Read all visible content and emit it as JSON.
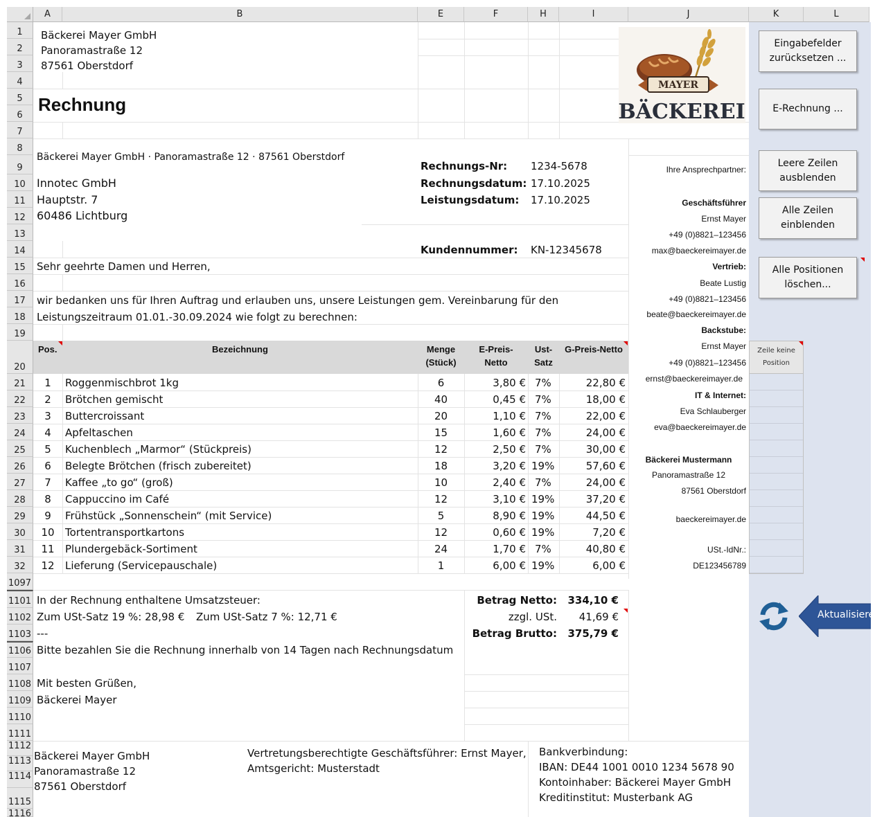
{
  "columns": [
    "A",
    "B",
    "E",
    "F",
    "H",
    "I",
    "J",
    "K",
    "L"
  ],
  "rows": {
    "r1": "1",
    "r2": "2",
    "r3": "3",
    "r4": "4",
    "r5": "5",
    "r6": "6",
    "r7": "7",
    "r8": "8",
    "r9": "9",
    "r10": "10",
    "r11": "11",
    "r12": "12",
    "r13": "13",
    "r14": "14",
    "r15": "15",
    "r16": "16",
    "r17": "17",
    "r18": "18",
    "r19": "19",
    "r20": "20",
    "r21": "21",
    "r22": "22",
    "r23": "23",
    "r24": "24",
    "r25": "25",
    "r26": "26",
    "r27": "27",
    "r28": "28",
    "r29": "29",
    "r30": "30",
    "r31": "31",
    "r32": "32",
    "r1097": "1097",
    "r1101": "1101",
    "r1102": "1102",
    "r1103": "1103",
    "r1106": "1106",
    "r1107": "1107",
    "r1108": "1108",
    "r1109": "1109",
    "r1110": "1110",
    "r1111": "1111",
    "r1112": "1112",
    "r1113": "1113",
    "r1114": "1114",
    "r1115": "1115",
    "r1116": "1116"
  },
  "sender": {
    "name": "Bäckerei Mayer GmbH",
    "street": "Panoramastraße 12",
    "city": "87561 Oberstdorf"
  },
  "title": "Rechnung",
  "logo": {
    "badge": "MAYER",
    "word": "BÄCKEREI"
  },
  "return_line": "Bäckerei Mayer GmbH · Panoramastraße 12 · 87561 Oberstdorf",
  "recipient": {
    "name": "Innotec GmbH",
    "street": "Hauptstr. 7",
    "city": "60486 Lichtburg"
  },
  "meta": {
    "invoice_no_label": "Rechnungs-Nr:",
    "invoice_no": "1234-5678",
    "invoice_date_label": "Rechnungsdatum:",
    "invoice_date": "17.10.2025",
    "service_date_label": "Leistungsdatum:",
    "service_date": "17.10.2025",
    "customer_no_label": "Kundennummer:",
    "customer_no": "KN-12345678"
  },
  "salutation": "Sehr geehrte Damen und Herren,",
  "intro1": "wir bedanken uns für Ihren Auftrag und erlauben uns, unsere Leistungen gem. Vereinbarung für den",
  "intro2": "Leistungszeitraum 01.01.-30.09.2024 wie folgt zu berechnen:",
  "table_header": {
    "pos": "Pos.",
    "desc": "Bezeichnung",
    "qty1": "Menge",
    "qty2": "(Stück)",
    "unit1": "E-Preis-",
    "unit2": "Netto",
    "vat1": "Ust-",
    "vat2": "Satz",
    "total": "G-Preis-Netto"
  },
  "items": [
    {
      "pos": "1",
      "desc": "Roggenmischbrot 1kg",
      "qty": "6",
      "unit": "3,80 €",
      "vat": "7%",
      "total": "22,80 €"
    },
    {
      "pos": "2",
      "desc": "Brötchen gemischt",
      "qty": "40",
      "unit": "0,45 €",
      "vat": "7%",
      "total": "18,00 €"
    },
    {
      "pos": "3",
      "desc": "Buttercroissant",
      "qty": "20",
      "unit": "1,10 €",
      "vat": "7%",
      "total": "22,00 €"
    },
    {
      "pos": "4",
      "desc": "Apfeltaschen",
      "qty": "15",
      "unit": "1,60 €",
      "vat": "7%",
      "total": "24,00 €"
    },
    {
      "pos": "5",
      "desc": "Kuchenblech „Marmor“ (Stückpreis)",
      "qty": "12",
      "unit": "2,50 €",
      "vat": "7%",
      "total": "30,00 €"
    },
    {
      "pos": "6",
      "desc": "Belegte Brötchen (frisch zubereitet)",
      "qty": "18",
      "unit": "3,20 €",
      "vat": "19%",
      "total": "57,60 €"
    },
    {
      "pos": "7",
      "desc": "Kaffee „to go“ (groß)",
      "qty": "10",
      "unit": "2,40 €",
      "vat": "7%",
      "total": "24,00 €"
    },
    {
      "pos": "8",
      "desc": "Cappuccino im Café",
      "qty": "12",
      "unit": "3,10 €",
      "vat": "19%",
      "total": "37,20 €"
    },
    {
      "pos": "9",
      "desc": "Frühstück „Sonnenschein“ (mit Service)",
      "qty": "5",
      "unit": "8,90 €",
      "vat": "19%",
      "total": "44,50 €"
    },
    {
      "pos": "10",
      "desc": "Tortentransportkartons",
      "qty": "12",
      "unit": "0,60 €",
      "vat": "19%",
      "total": "7,20 €"
    },
    {
      "pos": "11",
      "desc": "Plundergebäck-Sortiment",
      "qty": "24",
      "unit": "1,70 €",
      "vat": "7%",
      "total": "40,80 €"
    },
    {
      "pos": "12",
      "desc": "Lieferung (Servicepauschale)",
      "qty": "1",
      "unit": "6,00 €",
      "vat": "19%",
      "total": "6,00 €"
    }
  ],
  "vat_summary": {
    "heading": "In der Rechnung enthaltene Umsatzsteuer:",
    "line19": "Zum USt-Satz 19 %:  28,98 €",
    "line7": "Zum USt-Satz 7 %:  12,71 €",
    "dashes": "---"
  },
  "totals": {
    "net_label": "Betrag Netto:",
    "net": "334,10 €",
    "vat_label": "zzgl. USt.",
    "vat": "41,69 €",
    "gross_label": "Betrag Brutto:",
    "gross": "375,79 €"
  },
  "payment_note": "Bitte bezahlen Sie die Rechnung innerhalb von 14 Tagen nach Rechnungsdatum",
  "closing": "Mit besten Grüßen,",
  "signature": "Bäckerei Mayer",
  "footer": {
    "c1_1": "Bäckerei Mayer GmbH",
    "c1_2": "Panoramastraße 12",
    "c1_3": "87561 Oberstdorf",
    "c2_1": "Vertretungsberechtigte Geschäftsführer: Ernst Mayer,",
    "c2_2": "Amtsgericht: Musterstadt",
    "c3_1": "Bankverbindung:",
    "c3_2": "IBAN: DE44 1001 0010 1234 5678 90",
    "c3_3": "Kontoinhaber: Bäckerei Mayer GmbH",
    "c3_4": "Kreditinstitut: Musterbank AG"
  },
  "contacts": {
    "heading": "Ihre Ansprechpartner:",
    "gf_title": "Geschäftsführer",
    "gf_name": "Ernst Mayer",
    "gf_phone": "+49 (0)8821–123456",
    "gf_mail": "max@baeckereimayer.de",
    "v_title": "Vertrieb:",
    "v_name": "Beate Lustig",
    "v_phone": "+49 (0)8821–123456",
    "v_mail": "beate@baeckereimayer.de",
    "b_title": "Backstube:",
    "b_name": "Ernst Mayer",
    "b_phone": "+49 (0)8821–123456",
    "b_mail": "ernst@baeckereimayer.de",
    "it_title": "IT & Internet:",
    "it_name": "Eva Schlauberger",
    "it_mail": "eva@baeckereimayer.de",
    "co_name": "Bäckerei Mustermann",
    "co_street": "Panoramastraße 12",
    "co_city": "87561 Oberstdorf",
    "co_web": "baeckereimayer.de",
    "vat_id_label": "USt.-IdNr.:",
    "vat_id": "DE123456789"
  },
  "k_header": {
    "l1": "Zeile keine",
    "l2": "Position"
  },
  "buttons": {
    "reset_1": "Eingabefelder",
    "reset_2": "zurücksetzen ...",
    "erechnung": "E-Rechnung ...",
    "hide_1": "Leere Zeilen",
    "hide_2": "ausblenden",
    "show_1": "Alle Zeilen",
    "show_2": "einblenden",
    "delete_1": "Alle Positionen",
    "delete_2": "löschen...",
    "update": "Aktualisieren"
  },
  "colors": {
    "panel": "#dde3ef",
    "header_fill": "#d9d9d9",
    "arrow": "#2e5597",
    "refresh": "#1f5f96"
  }
}
